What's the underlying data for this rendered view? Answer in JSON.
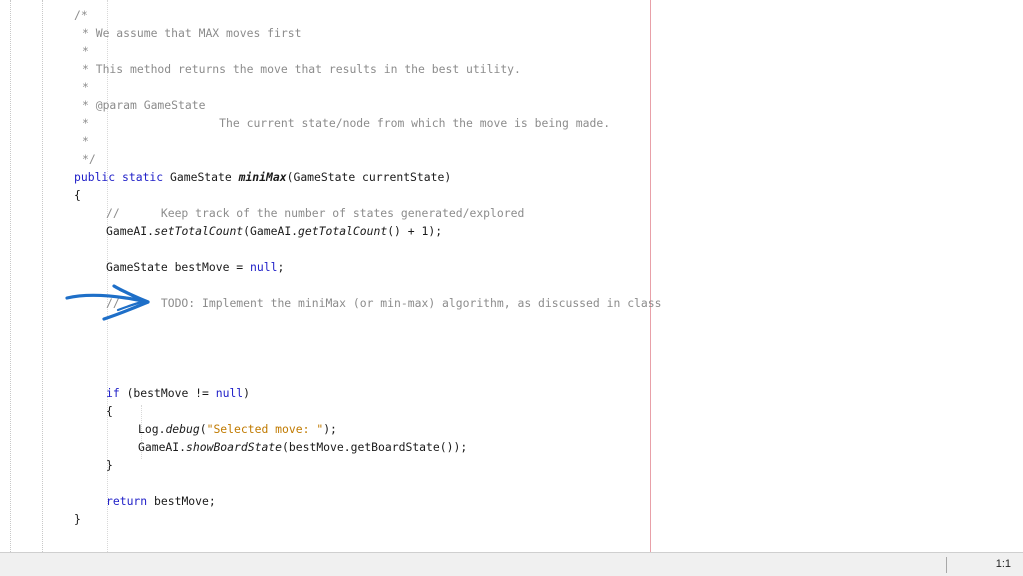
{
  "editor": {
    "code_lines": [
      {
        "indent": "    ",
        "parts": [
          {
            "t": "/*",
            "cls": "c"
          }
        ]
      },
      {
        "indent": "     ",
        "parts": [
          {
            "t": "* We assume that MAX moves first",
            "cls": "c"
          }
        ]
      },
      {
        "indent": "     ",
        "parts": [
          {
            "t": "*",
            "cls": "c"
          }
        ]
      },
      {
        "indent": "     ",
        "parts": [
          {
            "t": "* This method returns the move that results in the best utility.",
            "cls": "c"
          }
        ]
      },
      {
        "indent": "     ",
        "parts": [
          {
            "t": "*",
            "cls": "c"
          }
        ]
      },
      {
        "indent": "     ",
        "parts": [
          {
            "t": "* @param GameState",
            "cls": "c"
          }
        ]
      },
      {
        "indent": "     ",
        "parts": [
          {
            "t": "*                   The current state/node from which the move is being made.",
            "cls": "c"
          }
        ]
      },
      {
        "indent": "     ",
        "parts": [
          {
            "t": "*",
            "cls": "c"
          }
        ]
      },
      {
        "indent": "     ",
        "parts": [
          {
            "t": "*/",
            "cls": "c"
          }
        ]
      },
      {
        "indent": "    ",
        "parts": [
          {
            "t": "public static",
            "cls": "kw"
          },
          {
            "t": " GameState ",
            "cls": ""
          },
          {
            "t": "miniMax",
            "cls": "bi"
          },
          {
            "t": "(GameState currentState)",
            "cls": ""
          }
        ]
      },
      {
        "indent": "    ",
        "parts": [
          {
            "t": "{",
            "cls": ""
          }
        ]
      },
      {
        "indent": "        ",
        "parts": [
          {
            "t": "//      Keep track of the number of states generated/explored",
            "cls": "c"
          }
        ]
      },
      {
        "indent": "        ",
        "parts": [
          {
            "t": "GameAI.",
            "cls": ""
          },
          {
            "t": "setTotalCount",
            "cls": "it"
          },
          {
            "t": "(GameAI.",
            "cls": ""
          },
          {
            "t": "getTotalCount",
            "cls": "it"
          },
          {
            "t": "() + 1);",
            "cls": ""
          }
        ]
      },
      {
        "indent": "",
        "parts": []
      },
      {
        "indent": "        ",
        "parts": [
          {
            "t": "GameState bestMove = ",
            "cls": ""
          },
          {
            "t": "null",
            "cls": "kw"
          },
          {
            "t": ";",
            "cls": ""
          }
        ]
      },
      {
        "indent": "",
        "parts": []
      },
      {
        "indent": "        ",
        "parts": [
          {
            "t": "//      TODO: Implement the miniMax (or min-max) algorithm, as discussed in class",
            "cls": "c"
          }
        ]
      },
      {
        "indent": "",
        "parts": []
      },
      {
        "indent": "",
        "parts": []
      },
      {
        "indent": "",
        "parts": []
      },
      {
        "indent": "",
        "parts": []
      },
      {
        "indent": "        ",
        "parts": [
          {
            "t": "if",
            "cls": "kw"
          },
          {
            "t": " (bestMove != ",
            "cls": ""
          },
          {
            "t": "null",
            "cls": "kw"
          },
          {
            "t": ")",
            "cls": ""
          }
        ]
      },
      {
        "indent": "        ",
        "parts": [
          {
            "t": "{",
            "cls": ""
          }
        ]
      },
      {
        "indent": "            ",
        "parts": [
          {
            "t": "Log.",
            "cls": ""
          },
          {
            "t": "debug",
            "cls": "it"
          },
          {
            "t": "(",
            "cls": ""
          },
          {
            "t": "\"Selected move: \"",
            "cls": "str"
          },
          {
            "t": ");",
            "cls": ""
          }
        ]
      },
      {
        "indent": "            ",
        "parts": [
          {
            "t": "GameAI.",
            "cls": ""
          },
          {
            "t": "showBoardState",
            "cls": "it"
          },
          {
            "t": "(bestMove.getBoardState());",
            "cls": ""
          }
        ]
      },
      {
        "indent": "        ",
        "parts": [
          {
            "t": "}",
            "cls": ""
          }
        ]
      },
      {
        "indent": "",
        "parts": []
      },
      {
        "indent": "        ",
        "parts": [
          {
            "t": "return",
            "cls": "kw"
          },
          {
            "t": " bestMove;",
            "cls": ""
          }
        ]
      },
      {
        "indent": "    ",
        "parts": [
          {
            "t": "}",
            "cls": ""
          }
        ]
      }
    ]
  },
  "annotation": {
    "icon": "hand-drawn-arrow-icon",
    "color": "#1e6fc8"
  },
  "status_bar": {
    "cursor_position": "1:1"
  }
}
